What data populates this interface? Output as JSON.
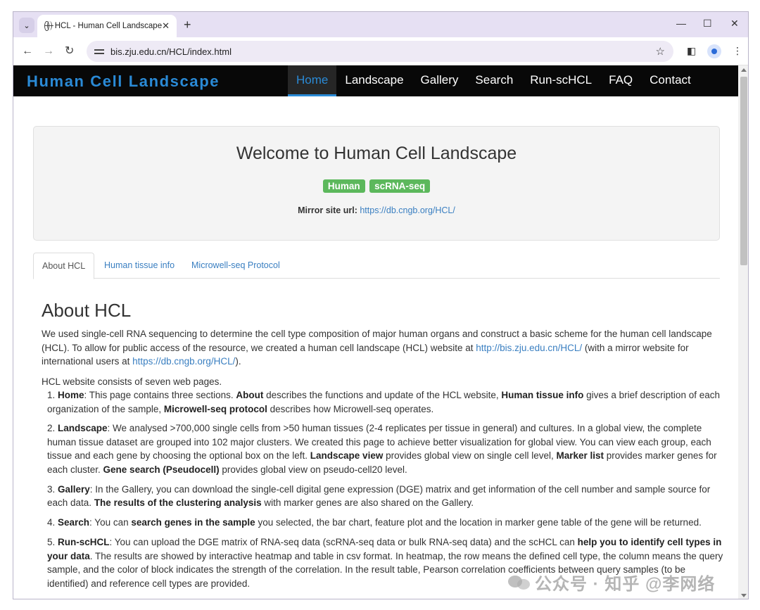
{
  "browser": {
    "tab_title": "HCL - Human Cell Landscape",
    "tab_close": "✕",
    "new_tab": "+",
    "url": "bis.zju.edu.cn/HCL/index.html",
    "window_controls": {
      "minimize": "—",
      "maximize": "☐",
      "close": "✕"
    }
  },
  "site": {
    "brand": "Human Cell Landscape",
    "nav": [
      "Home",
      "Landscape",
      "Gallery",
      "Search",
      "Run-scHCL",
      "FAQ",
      "Contact"
    ],
    "active_nav": "Home"
  },
  "jumbotron": {
    "title": "Welcome to Human Cell Landscape",
    "badges": [
      "Human",
      "scRNA-seq"
    ],
    "mirror_label": "Mirror site url:",
    "mirror_url": "https://db.cngb.org/HCL/"
  },
  "tabs": [
    "About HCL",
    "Human tissue info",
    "Microwell-seq Protocol"
  ],
  "about": {
    "heading": "About HCL",
    "p1_a": "We used single-cell RNA sequencing to determine the cell type composition of major human organs and construct a basic scheme for the human cell landscape (HCL). To allow for public access of the resource, we created a human cell landscape (HCL) website at ",
    "p1_link1": "http://bis.zju.edu.cn/HCL/",
    "p1_b": " (with a mirror website for international users at ",
    "p1_link2": "https://db.cngb.org/HCL/",
    "p1_c": ").",
    "intro": "HCL website consists of seven web pages.",
    "i1": [
      "1. ",
      "Home",
      ": This page contains three sections. ",
      "About",
      " describes the functions and update of the HCL website, ",
      "Human tissue info",
      " gives a brief description of each organization of the sample, ",
      "Microwell-seq protocol",
      " describes how Microwell-seq operates."
    ],
    "i2": [
      "2. ",
      "Landscape",
      ": We analysed >700,000 single cells from >50 human tissues (2-4 replicates per tissue in general) and cultures. In a global view, the complete human tissue dataset are grouped into 102 major clusters. We created this page to achieve better visualization for global view. You can view each group, each tissue and each gene by choosing the optional box on the left. ",
      "Landscape view",
      " provides global view on single cell level, ",
      "Marker list",
      " provides marker genes for each cluster. ",
      "Gene search (Pseudocell)",
      " provides global view on pseudo-cell20 level."
    ],
    "i3": [
      "3. ",
      "Gallery",
      ": In the Gallery, you can download the single-cell digital gene expression (DGE) matrix and get information of the cell number and sample source for each data. ",
      "The results of the clustering analysis",
      " with marker genes are also shared on the Gallery."
    ],
    "i4": [
      "4. ",
      "Search",
      ": You can ",
      "search genes in the sample",
      " you selected, the bar chart, feature plot and the location in marker gene table of the gene will be returned."
    ],
    "i5": [
      "5. ",
      "Run-scHCL",
      ": You can upload the DGE matrix of RNA-seq data (scRNA-seq data or bulk RNA-seq data) and the scHCL can ",
      "help you to identify cell types in your data",
      ". The results are showed by interactive heatmap and table in csv format. In heatmap, the row means the defined cell type, the column means the query sample, and the color of block indicates the strength of the correlation. In the result table, Pearson correlation coefficients between query samples (to be identified) and reference cell types are provided."
    ]
  },
  "watermark": "公众号 · 知乎 @李网络",
  "colors": {
    "brand": "#2a8ad6",
    "navbar": "#080808",
    "badge": "#5cb85c",
    "link": "#3a7fc1"
  }
}
